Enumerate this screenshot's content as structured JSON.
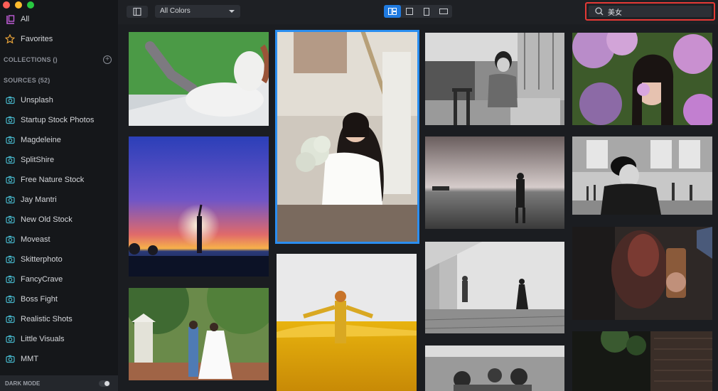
{
  "sidebar": {
    "all_label": "All",
    "favorites_label": "Favorites",
    "collections_label": "COLLECTIONS ()",
    "sources_label": "SOURCES (52)",
    "sources": [
      "Unsplash",
      "Startup Stock Photos",
      "Magdeleine",
      "SplitShire",
      "Free Nature Stock",
      "Jay Mantri",
      "New Old Stock",
      "Moveast",
      "Skitterphoto",
      "FancyCrave",
      "Boss Fight",
      "Realistic Shots",
      "Little Visuals",
      "MMT"
    ],
    "dark_mode_label": "DARK MODE"
  },
  "toolbar": {
    "color_filter_value": "All Colors",
    "search_value": "美女"
  },
  "colors": {
    "accent": "#1f7ae0",
    "selection": "#2b8ef0",
    "search_highlight": "#e53935",
    "favorite_star": "#e8a33a",
    "all_icon": "#c05dd8"
  }
}
